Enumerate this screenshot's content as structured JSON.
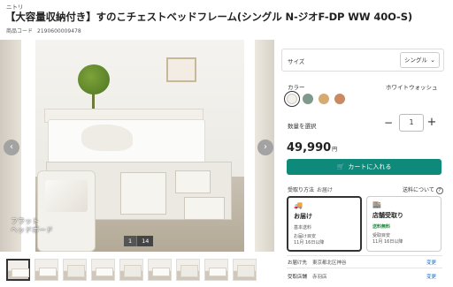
{
  "header": {
    "brand": "ニトリ",
    "title": "【大容量収納付き】すのこチェストベッドフレーム(シングル N-ジオF-DP WW 40O-S)",
    "code_label": "商品コード",
    "code_value": "2190600009478"
  },
  "gallery": {
    "callout_text": "フラット\nヘッドボード",
    "counter_current": "1",
    "counter_total": "14",
    "prev_icon": "chevron-left-icon",
    "next_icon": "chevron-right-icon",
    "thumbnail_count": 9,
    "selected_thumbnail": 1
  },
  "options": {
    "size_label": "サイズ",
    "size_value": "シングル",
    "color_label": "カラー",
    "color_value": "ホワイトウォッシュ",
    "swatches": [
      "#f4f1ea",
      "#7f9a8c",
      "#d6ab72",
      "#c98a62"
    ],
    "selected_swatch": 0,
    "qty_label": "数量を選択",
    "qty_value": "1",
    "qty_minus": "−",
    "qty_plus": "+"
  },
  "price": {
    "amount": "49,990",
    "unit": "円"
  },
  "cart": {
    "label": "カートに入れる",
    "accent": "#0e8a7a"
  },
  "delivery": {
    "method_label": "受取り方法",
    "method_sub": "お届け",
    "shipping_note": "送料について",
    "card_a": {
      "title": "お届け",
      "line1": "基本送料",
      "line2": "お届け目安",
      "line3": "11月 16日以降"
    },
    "card_b": {
      "title": "店舗受取り",
      "line1": "送料無料",
      "line2": "受取目安",
      "line3": "11月 16日以降"
    },
    "dest_label": "お届け先",
    "dest_value": "東京都北区神谷",
    "store_label": "受取店舗",
    "store_value": "赤羽店",
    "change_label": "変更"
  }
}
